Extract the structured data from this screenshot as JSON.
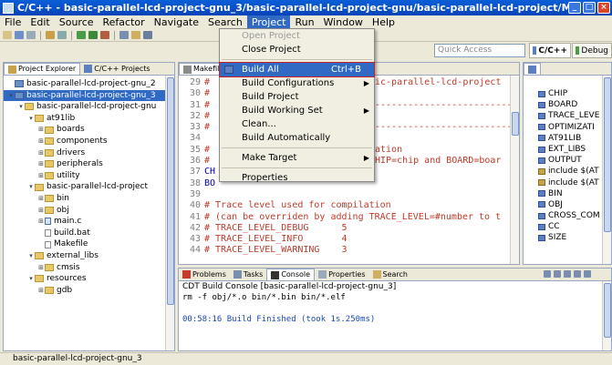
{
  "window": {
    "title": "C/C++ - basic-parallel-lcd-project-gnu_3/basic-parallel-lcd-project-gnu/basic-parallel-lcd-project/Makefile - Eclipse Platform",
    "minimize": "_",
    "maximize": "□",
    "close": "×"
  },
  "menubar": [
    "File",
    "Edit",
    "Source",
    "Refactor",
    "Navigate",
    "Search",
    "Project",
    "Run",
    "Window",
    "Help"
  ],
  "quick_access": {
    "placeholder": "Quick Access"
  },
  "perspectives": {
    "cdt": "C/C++",
    "debug": "Debug"
  },
  "project_menu": {
    "open_project": "Open Project",
    "close_project": "Close Project",
    "build_all": "Build All",
    "build_all_shortcut": "Ctrl+B",
    "build_configurations": "Build Configurations",
    "build_project": "Build Project",
    "build_working_set": "Build Working Set",
    "clean": "Clean...",
    "build_automatically": "Build Automatically",
    "make_target": "Make Target",
    "properties": "Properties"
  },
  "left_panel": {
    "tabs": [
      "Project Explorer",
      "C/C++ Projects"
    ],
    "tree": [
      {
        "label": "basic-parallel-lcd-project-gnu_2",
        "depth": 0,
        "type": "project",
        "twisty": ""
      },
      {
        "label": "basic-parallel-lcd-project-gnu_3",
        "depth": 0,
        "type": "project",
        "twisty": "▾",
        "selected": true
      },
      {
        "label": "basic-parallel-lcd-project-gnu",
        "depth": 1,
        "type": "folder",
        "twisty": "▾"
      },
      {
        "label": "at91lib",
        "depth": 2,
        "type": "folder",
        "twisty": "▾"
      },
      {
        "label": "boards",
        "depth": 3,
        "type": "folder",
        "twisty": "⊞"
      },
      {
        "label": "components",
        "depth": 3,
        "type": "folder",
        "twisty": "⊞"
      },
      {
        "label": "drivers",
        "depth": 3,
        "type": "folder",
        "twisty": "⊞"
      },
      {
        "label": "peripherals",
        "depth": 3,
        "type": "folder",
        "twisty": "⊞"
      },
      {
        "label": "utility",
        "depth": 3,
        "type": "folder",
        "twisty": "⊞"
      },
      {
        "label": "basic-parallel-lcd-project",
        "depth": 2,
        "type": "folder",
        "twisty": "▾"
      },
      {
        "label": "bin",
        "depth": 3,
        "type": "folder",
        "twisty": "⊞"
      },
      {
        "label": "obj",
        "depth": 3,
        "type": "folder",
        "twisty": "⊞"
      },
      {
        "label": "main.c",
        "depth": 3,
        "type": "cfile",
        "twisty": "⊞"
      },
      {
        "label": "build.bat",
        "depth": 3,
        "type": "file",
        "twisty": ""
      },
      {
        "label": "Makefile",
        "depth": 3,
        "type": "file",
        "twisty": ""
      },
      {
        "label": "external_libs",
        "depth": 2,
        "type": "folder",
        "twisty": "▾"
      },
      {
        "label": "cmsis",
        "depth": 3,
        "type": "folder",
        "twisty": "⊞"
      },
      {
        "label": "resources",
        "depth": 2,
        "type": "folder",
        "twisty": "▾"
      },
      {
        "label": "gdb",
        "depth": 3,
        "type": "folder",
        "twisty": "⊞"
      }
    ]
  },
  "editor": {
    "tab": "Makefile",
    "lines": [
      {
        "n": "29",
        "text": "#",
        "tail": "ic-parallel-lcd-project",
        "kind": "cm"
      },
      {
        "n": "30",
        "text": "#",
        "tail": "",
        "kind": "cm"
      },
      {
        "n": "31",
        "text": "#",
        "tail": "--------------------------",
        "kind": "cm"
      },
      {
        "n": "32",
        "text": "#",
        "tail": "",
        "kind": "cm"
      },
      {
        "n": "33",
        "text": "#",
        "tail": "--------------------------",
        "kind": "cm"
      },
      {
        "n": "34",
        "text": "",
        "tail": "",
        "kind": "cm"
      },
      {
        "n": "35",
        "text": "#",
        "tail": "ation",
        "kind": "cm"
      },
      {
        "n": "36",
        "text": "#",
        "tail": "HIP=chip and BOARD=boar",
        "kind": "cm"
      },
      {
        "n": "37",
        "text": "CH",
        "tail": "",
        "kind": "kw"
      },
      {
        "n": "38",
        "text": "BO",
        "tail": "",
        "kind": "kw"
      },
      {
        "n": "39",
        "text": "",
        "tail": "",
        "kind": "cm"
      },
      {
        "n": "40",
        "text": "# Trace level used for compilation",
        "tail": "",
        "kind": "cm"
      },
      {
        "n": "41",
        "text": "# (can be overriden by adding TRACE_LEVEL=#number to t",
        "tail": "",
        "kind": "cm"
      },
      {
        "n": "42",
        "text": "# TRACE_LEVEL_DEBUG      5",
        "tail": "",
        "kind": "cm"
      },
      {
        "n": "43",
        "text": "# TRACE_LEVEL_INFO       4",
        "tail": "",
        "kind": "cm"
      },
      {
        "n": "44",
        "text": "# TRACE_LEVEL_WARNING    3",
        "tail": "",
        "kind": "cm"
      }
    ]
  },
  "outline": {
    "items": [
      {
        "label": "CHIP",
        "kind": "var"
      },
      {
        "label": "BOARD",
        "kind": "var"
      },
      {
        "label": "TRACE_LEVE",
        "kind": "var"
      },
      {
        "label": "OPTIMIZATI",
        "kind": "var"
      },
      {
        "label": "AT91LIB",
        "kind": "var"
      },
      {
        "label": "EXT_LIBS",
        "kind": "var"
      },
      {
        "label": "OUTPUT",
        "kind": "var"
      },
      {
        "label": "include $(AT",
        "kind": "inc"
      },
      {
        "label": "include $(AT",
        "kind": "inc"
      },
      {
        "label": "BIN",
        "kind": "var"
      },
      {
        "label": "OBJ",
        "kind": "var"
      },
      {
        "label": "CROSS_COM",
        "kind": "var"
      },
      {
        "label": "CC",
        "kind": "var"
      },
      {
        "label": "SIZE",
        "kind": "var"
      }
    ]
  },
  "bottom_panel": {
    "tabs": [
      "Problems",
      "Tasks",
      "Console",
      "Properties",
      "Search"
    ],
    "console_header": "CDT Build Console [basic-parallel-lcd-project-gnu_3]",
    "line1": "rm -f obj/*.o bin/*.bin bin/*.elf",
    "line2": "00:58:16 Build Finished (took 1s.250ms)"
  },
  "statusbar": {
    "text": "basic-parallel-lcd-project-gnu_3"
  },
  "colors": {
    "title_blue": "#0843b8",
    "selection_blue": "#316ac5",
    "highlight_border": "#c82020"
  }
}
